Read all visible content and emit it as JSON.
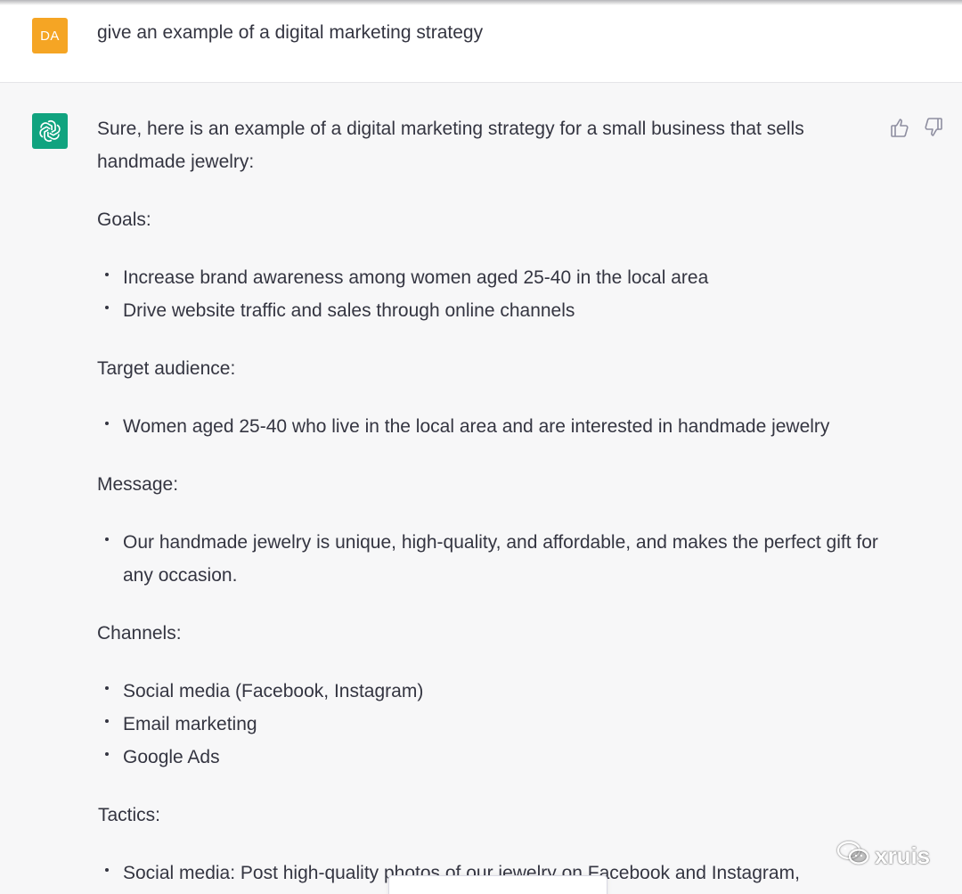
{
  "user_message": {
    "avatar_initials": "DA",
    "text": "give an example of a digital marketing strategy"
  },
  "assistant_message": {
    "avatar_icon": "openai-logo-icon",
    "intro": "Sure, here is an example of a digital marketing strategy for a small business that sells handmade jewelry:",
    "sections": {
      "goals": {
        "heading": "Goals:",
        "items": [
          "Increase brand awareness among women aged 25-40 in the local area",
          "Drive website traffic and sales through online channels"
        ]
      },
      "target_audience": {
        "heading": "Target audience:",
        "items": [
          "Women aged 25-40 who live in the local area and are interested in handmade jewelry"
        ]
      },
      "message": {
        "heading": "Message:",
        "items": [
          "Our handmade jewelry is unique, high-quality, and affordable, and makes the perfect gift for any occasion."
        ]
      },
      "channels": {
        "heading": "Channels:",
        "items": [
          "Social media (Facebook, Instagram)",
          "Email marketing",
          "Google Ads"
        ]
      },
      "tactics": {
        "heading": "Tactics:",
        "items": [
          "Social media: Post high-quality photos of our jewelry on Facebook and Instagram,"
        ]
      }
    },
    "feedback": {
      "thumbs_up_icon": "thumbs-up-icon",
      "thumbs_down_icon": "thumbs-down-icon"
    }
  },
  "watermark": {
    "text": "xruis",
    "icon": "wechat-icon"
  },
  "colors": {
    "user_avatar": "#f5a524",
    "bot_avatar": "#10a37f",
    "text": "#343541",
    "assistant_bg": "#f7f7f8",
    "user_bg": "#ffffff"
  }
}
